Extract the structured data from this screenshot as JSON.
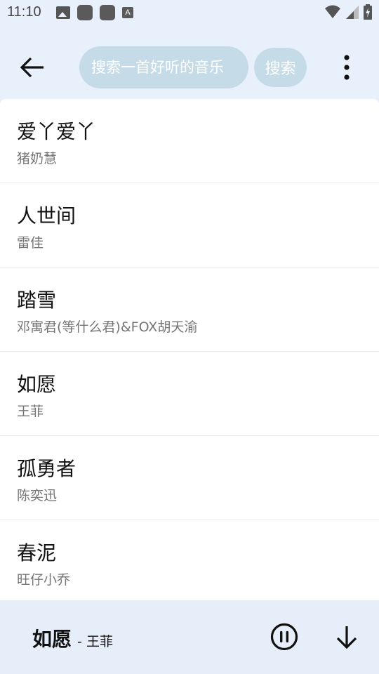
{
  "status_bar": {
    "time": "11:10",
    "icons_left": [
      "image-icon",
      "app-square-icon",
      "app-square-icon",
      "a-font-icon"
    ],
    "icons_right": [
      "wifi-icon",
      "cellular-signal-icon",
      "battery-charging-icon"
    ]
  },
  "toolbar": {
    "back_icon": "arrow-left-icon",
    "search_placeholder": "搜索一首好听的音乐",
    "search_value": "",
    "search_button_label": "搜索",
    "more_icon": "more-vert-icon"
  },
  "songs": [
    {
      "title": "爱丫爱丫",
      "artist": "猪奶慧"
    },
    {
      "title": "人世间",
      "artist": "雷佳"
    },
    {
      "title": "踏雪",
      "artist": "邓寓君(等什么君)&FOX胡天渝"
    },
    {
      "title": "如愿",
      "artist": "王菲"
    },
    {
      "title": "孤勇者",
      "artist": "陈奕迅"
    },
    {
      "title": "春泥",
      "artist": "旺仔小乔"
    }
  ],
  "player": {
    "title": "如愿",
    "separator": " - ",
    "artist": "王菲",
    "pause_icon": "pause-circle-icon",
    "download_icon": "download-arrow-icon"
  },
  "colors": {
    "background": "#e8f1fb",
    "search_pill": "#c5dbe7",
    "list_background": "#ffffff",
    "secondary_text": "#757575"
  }
}
